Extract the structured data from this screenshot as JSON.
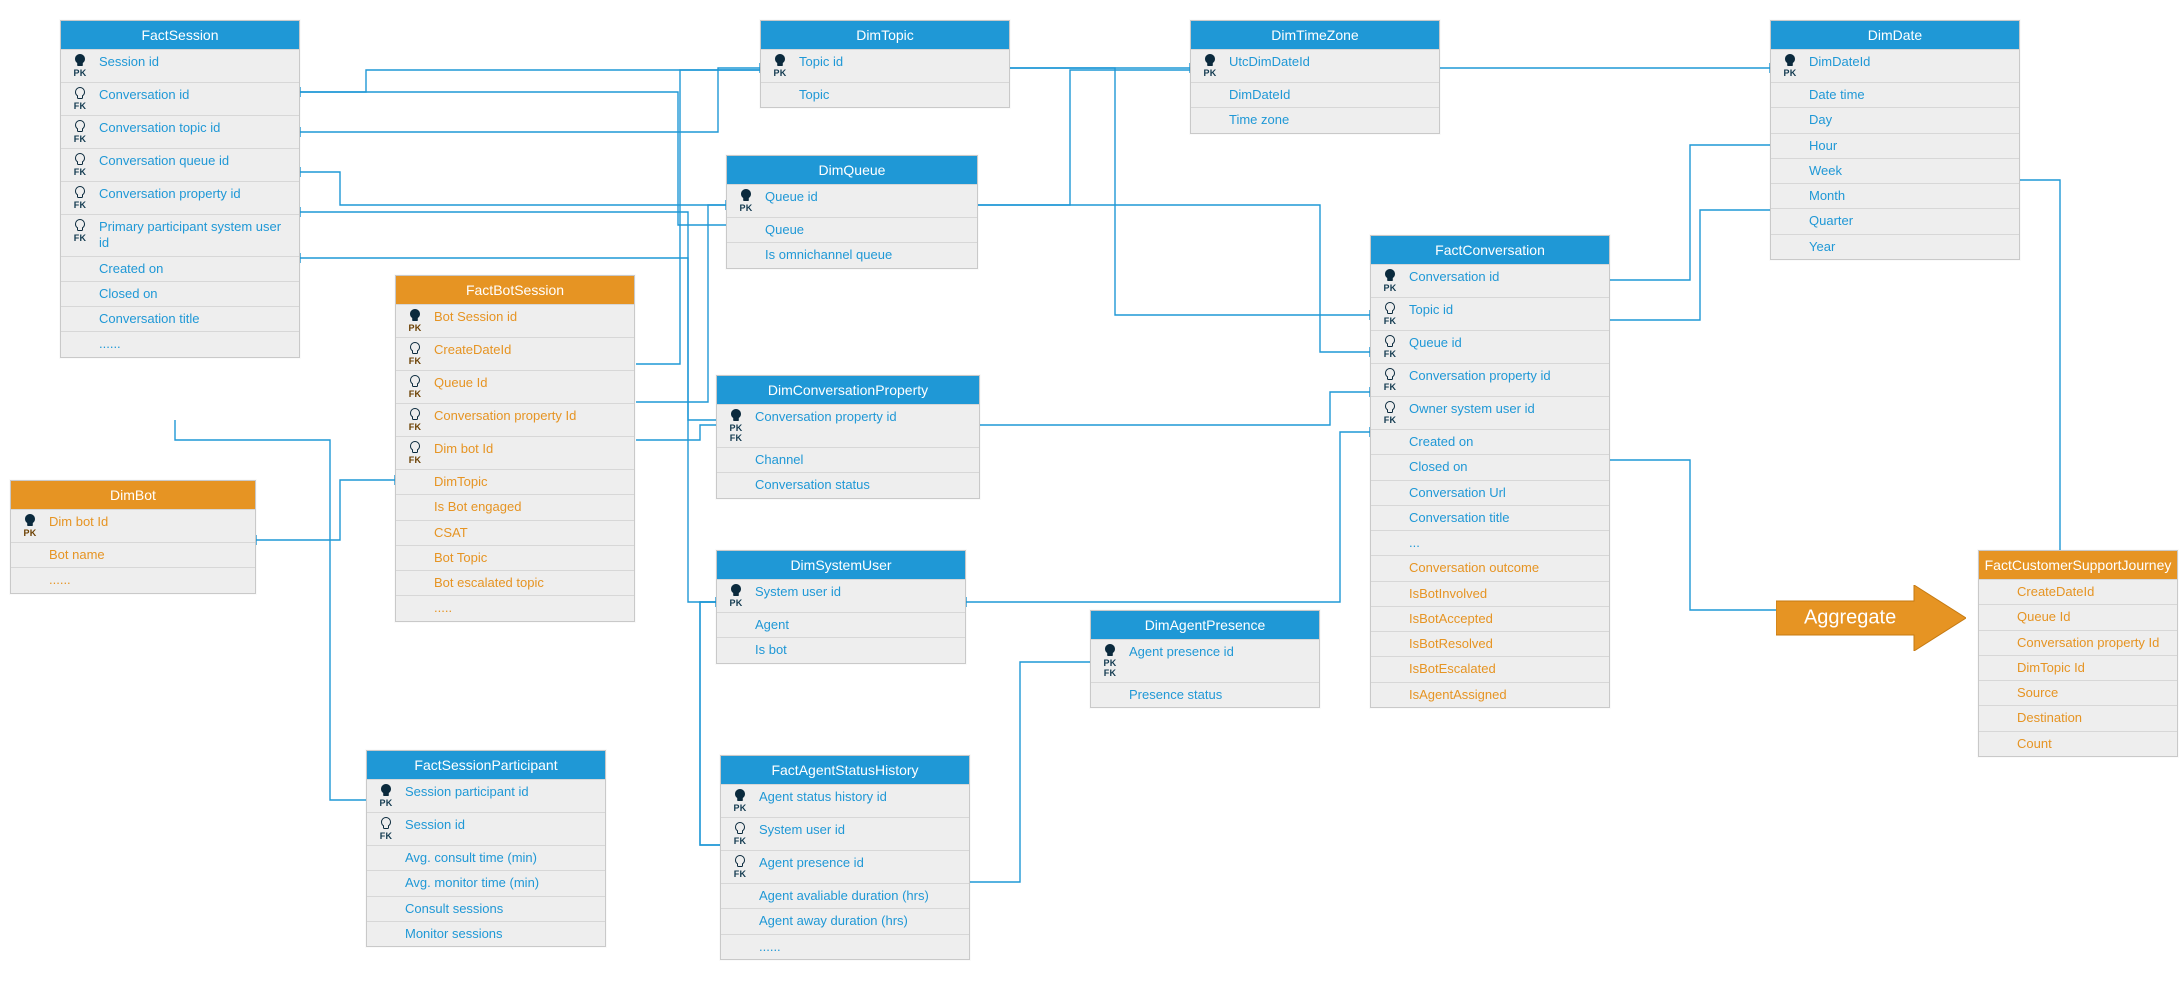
{
  "aggregate": {
    "label": "Aggregate"
  },
  "tables": {
    "factsession": {
      "title": "FactSession",
      "rows": [
        {
          "key": "PK",
          "label": "Session id"
        },
        {
          "key": "FK",
          "label": "Conversation id"
        },
        {
          "key": "FK",
          "label": "Conversation topic id"
        },
        {
          "key": "FK",
          "label": "Conversation queue id"
        },
        {
          "key": "FK",
          "label": "Conversation property id"
        },
        {
          "key": "FK",
          "label": "Primary participant system user id"
        },
        {
          "key": "",
          "label": "Created on"
        },
        {
          "key": "",
          "label": "Closed on"
        },
        {
          "key": "",
          "label": "Conversation title"
        },
        {
          "key": "",
          "label": "......"
        }
      ]
    },
    "dimbot": {
      "title": "DimBot",
      "rows": [
        {
          "key": "PK",
          "label": "Dim bot Id"
        },
        {
          "key": "",
          "label": "Bot name"
        },
        {
          "key": "",
          "label": "......"
        }
      ]
    },
    "factbotsession": {
      "title": "FactBotSession",
      "rows": [
        {
          "key": "PK",
          "label": "Bot Session id"
        },
        {
          "key": "FK",
          "label": "CreateDateId"
        },
        {
          "key": "FK",
          "label": "Queue Id"
        },
        {
          "key": "FK",
          "label": "Conversation property Id"
        },
        {
          "key": "FK",
          "label": "Dim bot Id"
        },
        {
          "key": "",
          "label": "DimTopic"
        },
        {
          "key": "",
          "label": "Is Bot engaged"
        },
        {
          "key": "",
          "label": "CSAT"
        },
        {
          "key": "",
          "label": "Bot Topic"
        },
        {
          "key": "",
          "label": "Bot escalated topic"
        },
        {
          "key": "",
          "label": "....."
        }
      ]
    },
    "factsessionpart": {
      "title": "FactSessionParticipant",
      "rows": [
        {
          "key": "PK",
          "label": "Session participant id"
        },
        {
          "key": "FK",
          "label": "Session id"
        },
        {
          "key": "",
          "label": "Avg. consult time (min)"
        },
        {
          "key": "",
          "label": "Avg. monitor time (min)"
        },
        {
          "key": "",
          "label": "Consult sessions"
        },
        {
          "key": "",
          "label": "Monitor sessions"
        }
      ]
    },
    "dimtopic": {
      "title": "DimTopic",
      "rows": [
        {
          "key": "PK",
          "label": "Topic id"
        },
        {
          "key": "",
          "label": "Topic"
        }
      ]
    },
    "dimqueue": {
      "title": "DimQueue",
      "rows": [
        {
          "key": "PK",
          "label": "Queue id"
        },
        {
          "key": "",
          "label": "Queue"
        },
        {
          "key": "",
          "label": "Is omnichannel queue"
        }
      ]
    },
    "dimconvprop": {
      "title": "DimConversationProperty",
      "rows": [
        {
          "key": "PKFK",
          "label": "Conversation property id"
        },
        {
          "key": "",
          "label": "Channel"
        },
        {
          "key": "",
          "label": "Conversation status"
        }
      ]
    },
    "dimsysuser": {
      "title": "DimSystemUser",
      "rows": [
        {
          "key": "PK",
          "label": "System user id"
        },
        {
          "key": "",
          "label": "Agent"
        },
        {
          "key": "",
          "label": "Is bot"
        }
      ]
    },
    "factagentstatus": {
      "title": "FactAgentStatusHistory",
      "rows": [
        {
          "key": "PK",
          "label": "Agent status history id"
        },
        {
          "key": "FK",
          "label": "System user id"
        },
        {
          "key": "FK",
          "label": "Agent presence id"
        },
        {
          "key": "",
          "label": "Agent avaliable duration (hrs)"
        },
        {
          "key": "",
          "label": "Agent away duration (hrs)"
        },
        {
          "key": "",
          "label": "......"
        }
      ]
    },
    "dimagentpresence": {
      "title": "DimAgentPresence",
      "rows": [
        {
          "key": "PKFK",
          "label": "Agent presence id"
        },
        {
          "key": "",
          "label": "Presence status"
        }
      ]
    },
    "dimtimezone": {
      "title": "DimTimeZone",
      "rows": [
        {
          "key": "PK",
          "label": "UtcDimDateId"
        },
        {
          "key": "",
          "label": "DimDateId"
        },
        {
          "key": "",
          "label": "Time zone"
        }
      ]
    },
    "factconversation": {
      "title": "FactConversation",
      "rows": [
        {
          "key": "PK",
          "label": "Conversation id"
        },
        {
          "key": "FK",
          "label": "Topic id"
        },
        {
          "key": "FK",
          "label": "Queue id"
        },
        {
          "key": "FK",
          "label": "Conversation property id"
        },
        {
          "key": "FK",
          "label": "Owner system user id"
        },
        {
          "key": "",
          "label": "Created on"
        },
        {
          "key": "",
          "label": "Closed on"
        },
        {
          "key": "",
          "label": "Conversation Url"
        },
        {
          "key": "",
          "label": "Conversation title"
        },
        {
          "key": "",
          "label": "..."
        },
        {
          "key": "",
          "label": "Conversation outcome",
          "alt": true
        },
        {
          "key": "",
          "label": "IsBotInvolved",
          "alt": true
        },
        {
          "key": "",
          "label": "IsBotAccepted",
          "alt": true
        },
        {
          "key": "",
          "label": "IsBotResolved",
          "alt": true
        },
        {
          "key": "",
          "label": "IsBotEscalated",
          "alt": true
        },
        {
          "key": "",
          "label": "IsAgentAssigned",
          "alt": true
        }
      ]
    },
    "dimdate": {
      "title": "DimDate",
      "rows": [
        {
          "key": "PK",
          "label": "DimDateId"
        },
        {
          "key": "",
          "label": "Date time"
        },
        {
          "key": "",
          "label": "Day"
        },
        {
          "key": "",
          "label": "Hour"
        },
        {
          "key": "",
          "label": "Week"
        },
        {
          "key": "",
          "label": "Month"
        },
        {
          "key": "",
          "label": "Quarter"
        },
        {
          "key": "",
          "label": "Year"
        }
      ]
    },
    "factcsj": {
      "title": "FactCustomerSupportJourney",
      "rows": [
        {
          "key": "",
          "label": "CreateDateId"
        },
        {
          "key": "",
          "label": "Queue Id"
        },
        {
          "key": "",
          "label": "Conversation property Id"
        },
        {
          "key": "",
          "label": "DimTopic Id"
        },
        {
          "key": "",
          "label": "Source"
        },
        {
          "key": "",
          "label": "Destination"
        },
        {
          "key": "",
          "label": "Count"
        }
      ]
    }
  }
}
